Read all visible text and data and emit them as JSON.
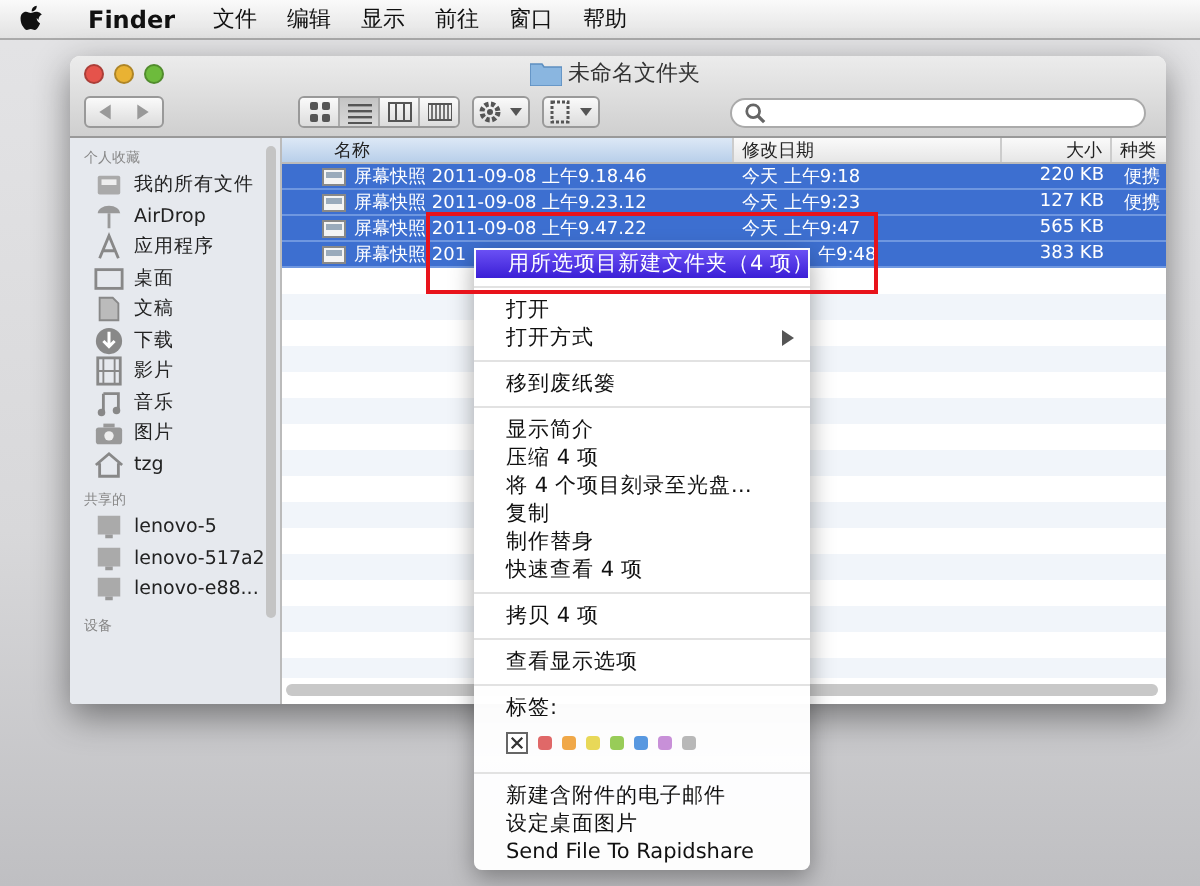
{
  "menubar": {
    "items": [
      "Finder",
      "文件",
      "编辑",
      "显示",
      "前往",
      "窗口",
      "帮助"
    ]
  },
  "window": {
    "title": "未命名文件夹",
    "view_buttons": [
      {
        "kind": "icons",
        "selected": false
      },
      {
        "kind": "list",
        "selected": true
      },
      {
        "kind": "columns",
        "selected": false
      },
      {
        "kind": "coverflow",
        "selected": false
      }
    ],
    "sidebar": [
      {
        "heading": "个人收藏",
        "items": [
          {
            "label": "我的所有文件",
            "kind": "files"
          },
          {
            "label": "AirDrop",
            "kind": "airdrop"
          },
          {
            "label": "应用程序",
            "kind": "apps"
          },
          {
            "label": "桌面",
            "kind": "desktop"
          },
          {
            "label": "文稿",
            "kind": "documents"
          },
          {
            "label": "下载",
            "kind": "downloads"
          },
          {
            "label": "影片",
            "kind": "movies"
          },
          {
            "label": "音乐",
            "kind": "music"
          },
          {
            "label": "图片",
            "kind": "pictures"
          },
          {
            "label": "tzg",
            "kind": "home"
          }
        ]
      },
      {
        "heading": "共享的",
        "items": [
          {
            "label": "lenovo-5",
            "kind": "computer"
          },
          {
            "label": "lenovo-517a2",
            "kind": "computer"
          },
          {
            "label": "lenovo-e88...",
            "kind": "computer"
          }
        ]
      },
      {
        "heading": "设备"
      }
    ],
    "table": {
      "columns": [
        "名称",
        "修改日期",
        "大小",
        "种类"
      ],
      "rows": [
        {
          "name": "屏幕快照 2011-09-08 上午9.18.46",
          "date": "今天 上午9:18",
          "size": "220 KB",
          "kind": "便携",
          "selected": true,
          "under_menu": false
        },
        {
          "name": "屏幕快照 2011-09-08 上午9.23.12",
          "date": "今天 上午9:23",
          "size": "127 KB",
          "kind": "便携",
          "selected": true,
          "under_menu": false
        },
        {
          "name": "屏幕快照 2011-09-08 上午9.47.22",
          "date": "今天 上午9:47",
          "size": "565 KB",
          "selected": true,
          "under_menu": false
        },
        {
          "name": "屏幕快照 201",
          "date": "午9:48",
          "size": "383 KB",
          "selected": true,
          "under_menu": true
        }
      ]
    }
  },
  "context_menu": {
    "groups": [
      [
        {
          "label": "用所选项目新建文件夹（4 项）",
          "kind": "item",
          "selected": true
        }
      ],
      [
        {
          "label": "打开",
          "kind": "item",
          "selected": false
        },
        {
          "label": "打开方式",
          "kind": "submenu",
          "selected": false
        }
      ],
      [
        {
          "label": "移到废纸篓",
          "kind": "item",
          "selected": false
        }
      ],
      [
        {
          "label": "显示简介",
          "kind": "item",
          "selected": false
        },
        {
          "label": "压缩 4 项",
          "kind": "item",
          "selected": false
        },
        {
          "label": "将 4 个项目刻录至光盘…",
          "kind": "item",
          "selected": false
        },
        {
          "label": "复制",
          "kind": "item",
          "selected": false
        },
        {
          "label": "制作替身",
          "kind": "item",
          "selected": false
        },
        {
          "label": "快速查看 4 项",
          "kind": "item",
          "selected": false
        }
      ],
      [
        {
          "label": "拷贝 4 项",
          "kind": "item",
          "selected": false
        }
      ],
      [
        {
          "label": "查看显示选项",
          "kind": "item",
          "selected": false
        }
      ],
      [
        {
          "label": "标签:",
          "kind": "tags",
          "tags": [
            {
              "color": "#ffffff"
            },
            {
              "color": "#e06868"
            },
            {
              "color": "#f0a848"
            },
            {
              "color": "#e8d858"
            },
            {
              "color": "#98cc58"
            },
            {
              "color": "#5898e0"
            },
            {
              "color": "#c890d8"
            },
            {
              "color": "#b8b8b8"
            }
          ]
        }
      ],
      [
        {
          "label": "新建含附件的电子邮件",
          "kind": "item",
          "selected": false
        },
        {
          "label": "设定桌面图片",
          "kind": "item",
          "selected": false
        },
        {
          "label": "Send File To Rapidshare",
          "kind": "item",
          "selected": false
        }
      ]
    ]
  }
}
